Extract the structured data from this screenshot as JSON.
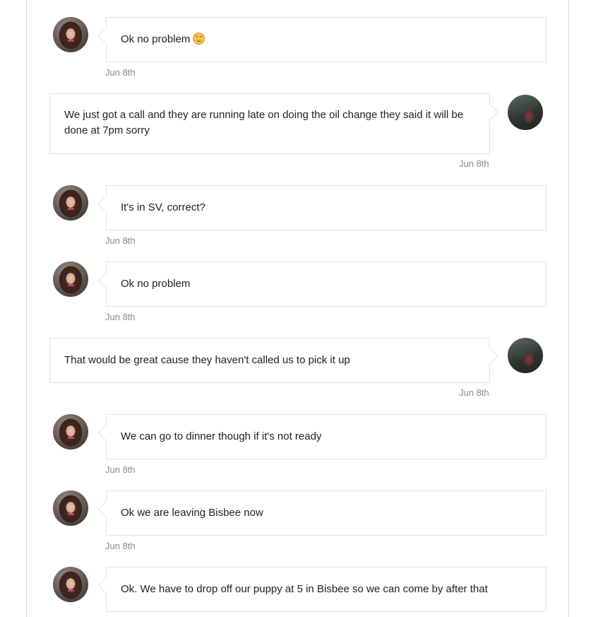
{
  "messages": [
    {
      "side": "left",
      "text": "Ok no problem",
      "emoji": "smiling-face-emoji",
      "date": "Jun 8th"
    },
    {
      "side": "right",
      "text": "We just got a call and they are running  late on doing the oil change they said it will be done at 7pm sorry",
      "date": "Jun 8th"
    },
    {
      "side": "left",
      "text": "It's in SV, correct?",
      "date": "Jun 8th"
    },
    {
      "side": "left",
      "text": "Ok no problem",
      "date": "Jun 8th"
    },
    {
      "side": "right",
      "text": "That would be great cause they haven't called us to pick it up",
      "date": "Jun 8th"
    },
    {
      "side": "left",
      "text": "We can go to dinner though if it's not ready",
      "date": "Jun 8th"
    },
    {
      "side": "left",
      "text": "Ok we are leaving Bisbee now",
      "date": "Jun 8th"
    },
    {
      "side": "left",
      "text": "Ok. We have to drop off our puppy at 5 in Bisbee so we can come by after that"
    }
  ]
}
